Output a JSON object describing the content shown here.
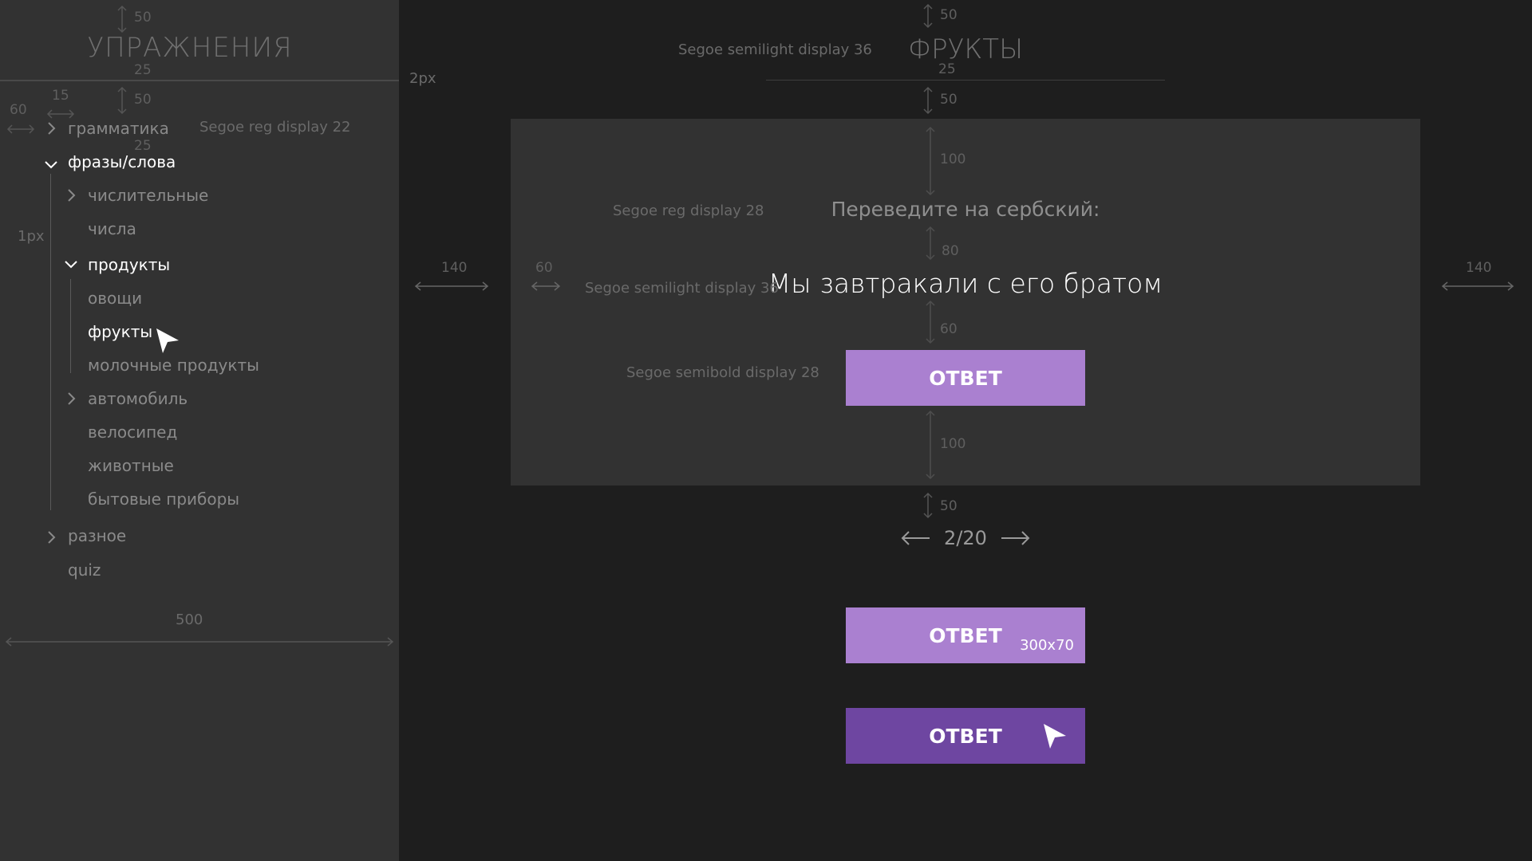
{
  "sidebar": {
    "title": "УПРАЖНЕНИЯ",
    "items": [
      {
        "label": "грамматика",
        "chevron": "right"
      },
      {
        "label": "фразы/слова",
        "chevron": "down"
      },
      {
        "label": "числительные",
        "chevron": "right"
      },
      {
        "label": "числа"
      },
      {
        "label": "продукты",
        "chevron": "down"
      },
      {
        "label": "овощи"
      },
      {
        "label": "фрукты",
        "selected": true
      },
      {
        "label": "молочные продукты"
      },
      {
        "label": "автомобиль",
        "chevron": "right"
      },
      {
        "label": "велосипед"
      },
      {
        "label": "животные"
      },
      {
        "label": "бытовые приборы"
      },
      {
        "label": "разное",
        "chevron": "right"
      },
      {
        "label": "quiz"
      }
    ]
  },
  "main": {
    "title": "ФРУКТЫ",
    "prompt": "Переведите на сербский:",
    "phrase": "Мы завтракали с его братом",
    "answer_label": "ОТВЕТ",
    "pager": {
      "current": "2/20"
    },
    "button_states": [
      {
        "label": "ОТВЕТ",
        "note": "300x70"
      },
      {
        "label": "ОТВЕТ"
      }
    ]
  },
  "annotations": {
    "sb_50_top": "50",
    "sb_25": "25",
    "sb_50_b": "50",
    "sb_15": "15",
    "sb_60": "60",
    "sb_font22": "Segoe reg display 22",
    "sb_25_b": "25",
    "sb_1px": "1px",
    "sb_500": "500",
    "m_2px": "2px",
    "m_50_top": "50",
    "m_font_title": "Segoe semilight display 36",
    "m_25": "25",
    "m_50_b": "50",
    "m_100_a": "100",
    "m_font28": "Segoe reg display 28",
    "m_80": "80",
    "m_140_l": "140",
    "m_60_l": "60",
    "m_font36": "Segoe semilight display 36",
    "m_140_r": "140",
    "m_60": "60",
    "m_font_btn": "Segoe semibold display 28",
    "m_100_b": "100",
    "m_50_c": "50"
  },
  "colors": {
    "sidebar_bg": "#323232",
    "main_bg": "#1e1e1e",
    "card_bg": "#323232",
    "accent": "#aa80d0",
    "accent_pressed": "#6e46a1"
  },
  "icons": {
    "expand": "chevron-right-icon",
    "collapse": "chevron-down-icon",
    "prev": "arrow-left-icon",
    "next": "arrow-right-icon",
    "pointer": "mouse-pointer-icon"
  }
}
